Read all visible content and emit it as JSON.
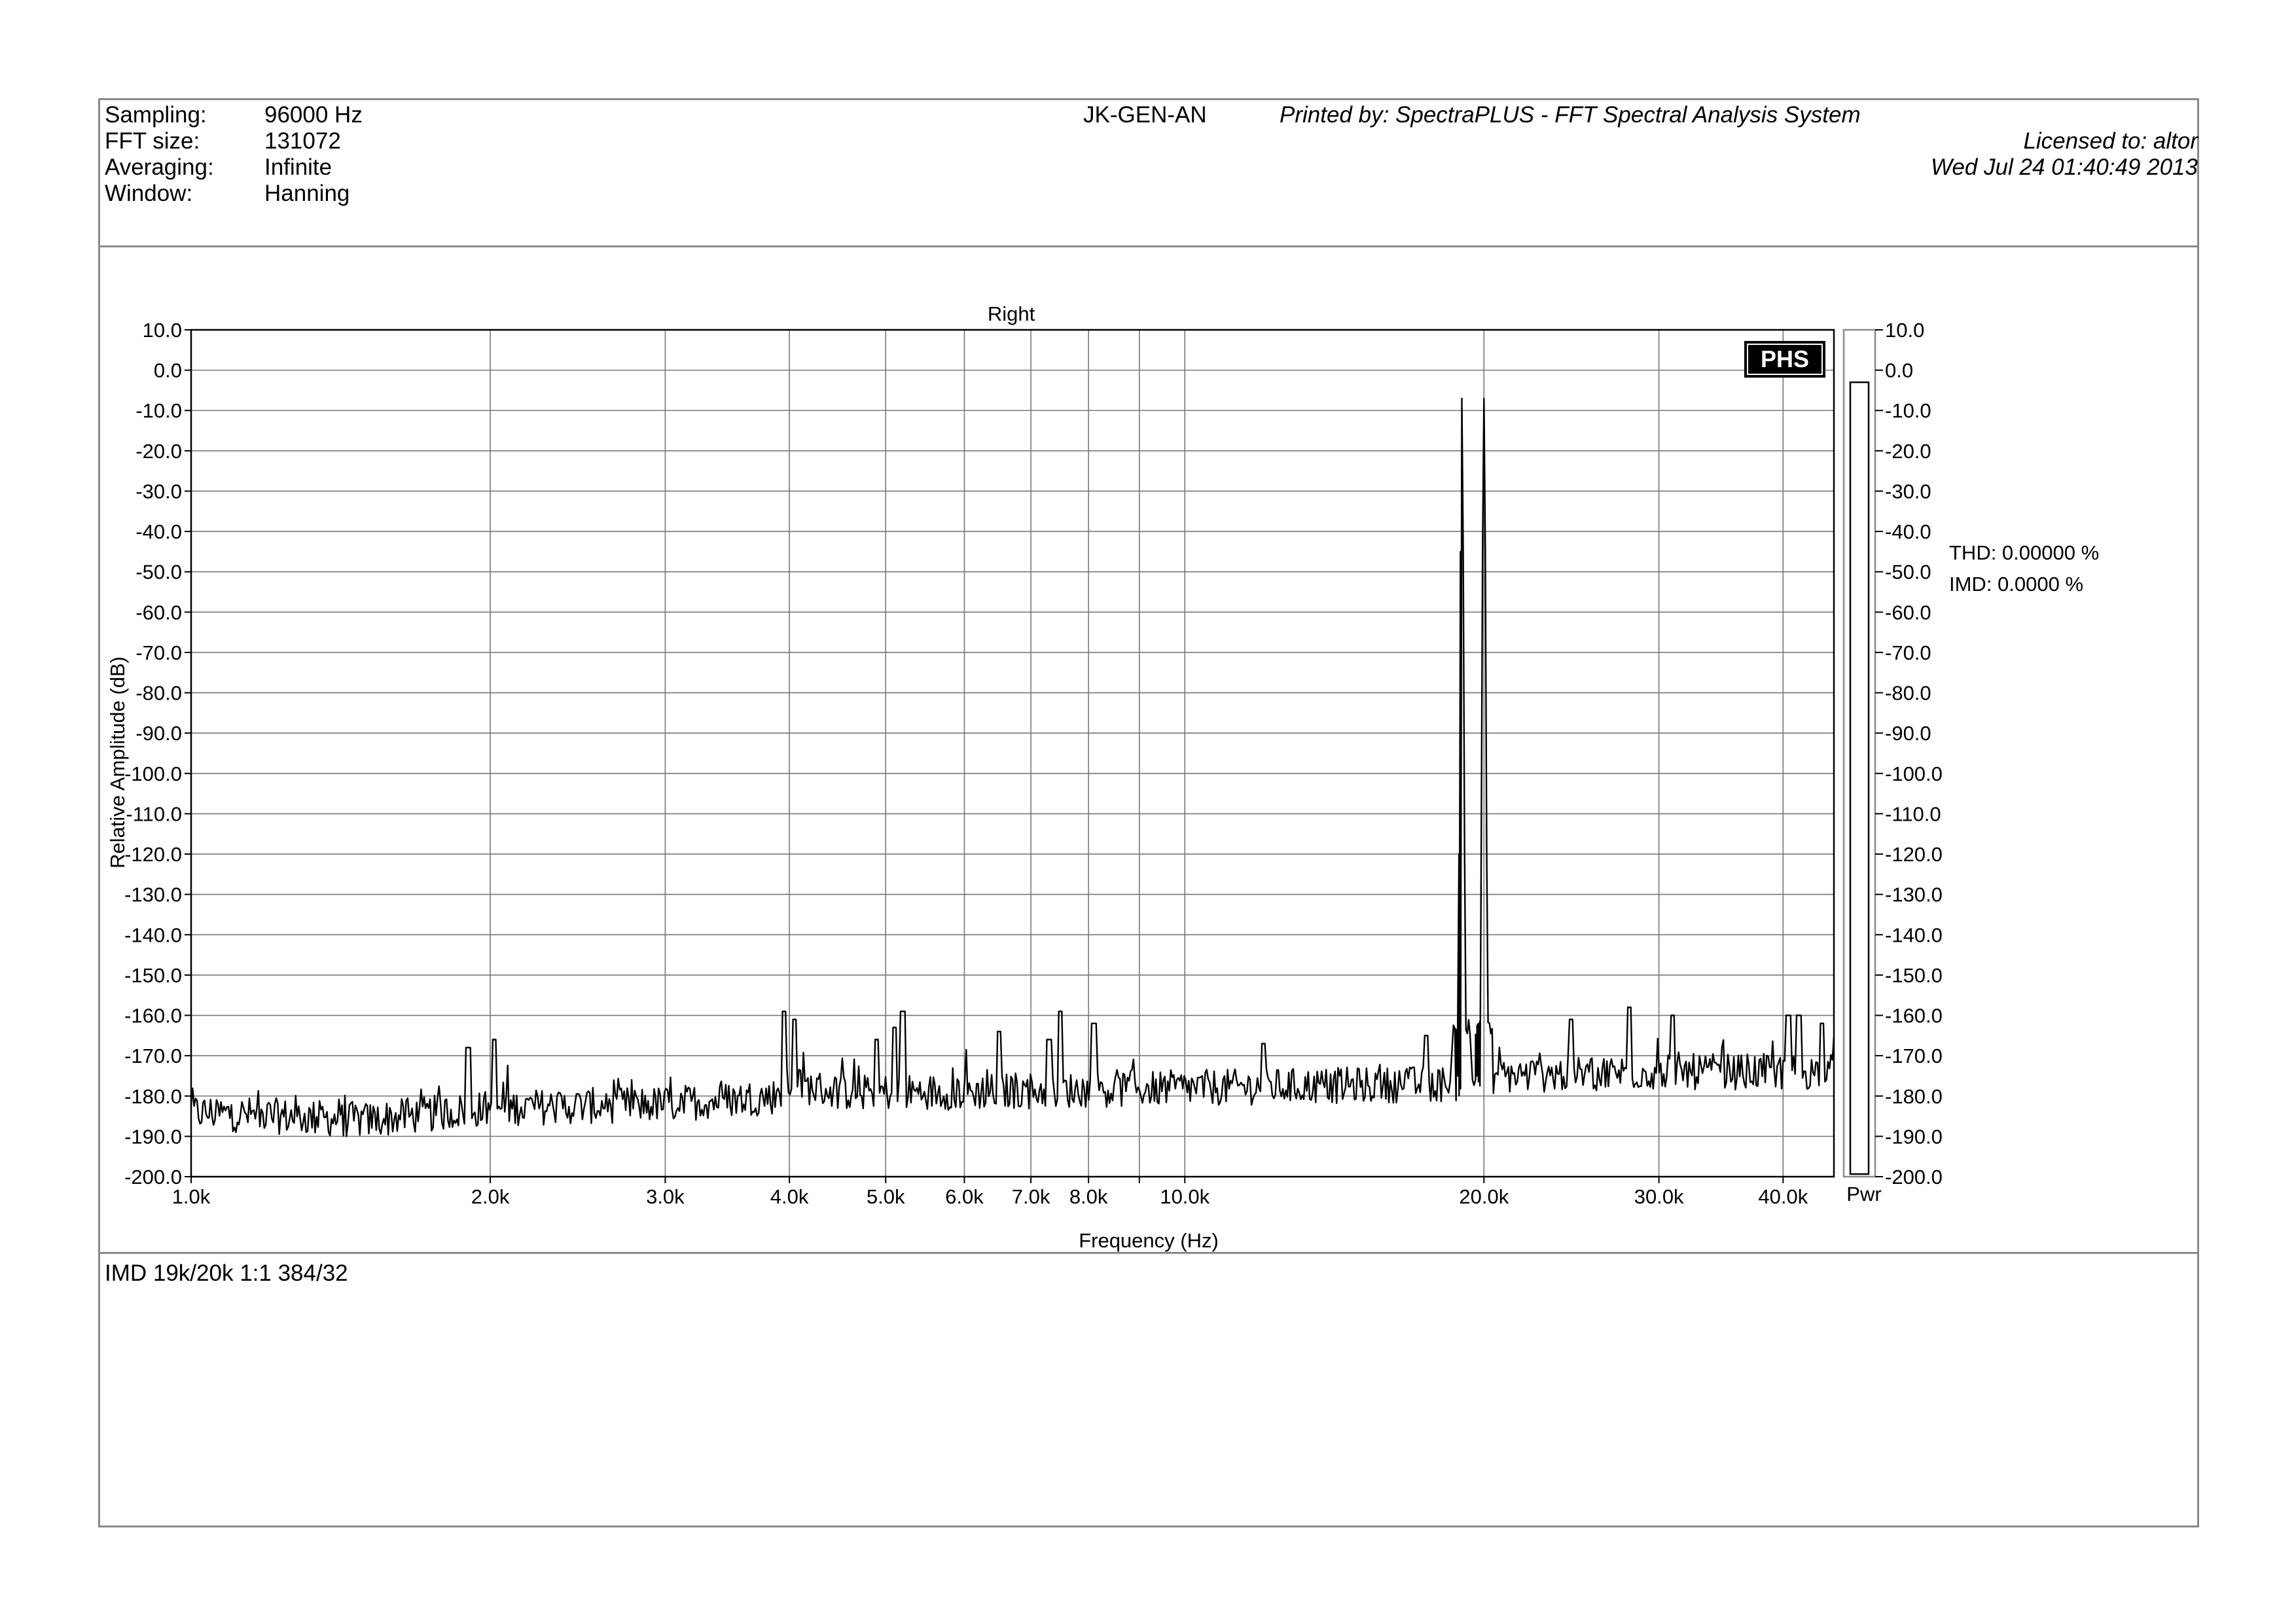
{
  "header": {
    "params": [
      {
        "label": "Sampling:",
        "value": "96000 Hz"
      },
      {
        "label": "FFT size:",
        "value": "131072"
      },
      {
        "label": "Averaging:",
        "value": "Infinite"
      },
      {
        "label": "Window:",
        "value": "Hanning"
      }
    ],
    "device": "JK-GEN-AN",
    "printed_by": "Printed by: SpectraPLUS - FFT Spectral Analysis System",
    "licensed_to": "Licensed to: altor",
    "timestamp": "Wed Jul 24 01:40:49 2013"
  },
  "footer": {
    "comment": "IMD 19k/20k 1:1 384/32"
  },
  "logo_text": "PHS",
  "stats": {
    "thd": "THD: 0.00000 %",
    "imd": "IMD: 0.0000 %"
  },
  "power_bar": {
    "label": "Pwr",
    "level_db": -3
  },
  "chart_data": {
    "type": "line",
    "title": "Right",
    "xlabel": "Frequency (Hz)",
    "ylabel": "Relative Amplitude (dB)",
    "x_scale": "log",
    "xlim": [
      1000,
      45000
    ],
    "ylim": [
      -200,
      10
    ],
    "grid": true,
    "x_ticks": [
      {
        "v": 1000,
        "label": "1.0k"
      },
      {
        "v": 2000,
        "label": "2.0k"
      },
      {
        "v": 3000,
        "label": "3.0k"
      },
      {
        "v": 4000,
        "label": "4.0k"
      },
      {
        "v": 5000,
        "label": "5.0k"
      },
      {
        "v": 6000,
        "label": "6.0k"
      },
      {
        "v": 7000,
        "label": "7.0k"
      },
      {
        "v": 8000,
        "label": "8.0k"
      },
      {
        "v": 9000,
        "label": ""
      },
      {
        "v": 10000,
        "label": "10.0k"
      },
      {
        "v": 20000,
        "label": "20.0k"
      },
      {
        "v": 30000,
        "label": "30.0k"
      },
      {
        "v": 40000,
        "label": "40.0k"
      }
    ],
    "y_ticks": [
      "10.0",
      "0.0",
      "-10.0",
      "-20.0",
      "-30.0",
      "-40.0",
      "-50.0",
      "-60.0",
      "-70.0",
      "-80.0",
      "-90.0",
      "-100.0",
      "-110.0",
      "-120.0",
      "-130.0",
      "-140.0",
      "-150.0",
      "-160.0",
      "-170.0",
      "-180.0",
      "-190.0",
      "-200.0"
    ],
    "noise_floor": [
      [
        1000,
        -184
      ],
      [
        1500,
        -186
      ],
      [
        2000,
        -183
      ],
      [
        3000,
        -182
      ],
      [
        3900,
        -180
      ],
      [
        4000,
        -177
      ],
      [
        4500,
        -179
      ],
      [
        6000,
        -179
      ],
      [
        10000,
        -178
      ],
      [
        18000,
        -177
      ],
      [
        18800,
        -177
      ],
      [
        20300,
        -175
      ],
      [
        30000,
        -174
      ],
      [
        45000,
        -174
      ]
    ],
    "peaks": [
      [
        1900,
        -168
      ],
      [
        2020,
        -166
      ],
      [
        3950,
        -159
      ],
      [
        4050,
        -161
      ],
      [
        4900,
        -166
      ],
      [
        5100,
        -163
      ],
      [
        5200,
        -159
      ],
      [
        6500,
        -164
      ],
      [
        7300,
        -166
      ],
      [
        7500,
        -159
      ],
      [
        8100,
        -162
      ],
      [
        12000,
        -167
      ],
      [
        17500,
        -165
      ],
      [
        24500,
        -161
      ],
      [
        28000,
        -158
      ],
      [
        31000,
        -160
      ],
      [
        40500,
        -160
      ],
      [
        41500,
        -160
      ],
      [
        43800,
        -162
      ]
    ],
    "series": [
      {
        "tones": [
          [
            19000,
            -7
          ],
          [
            20000,
            -7
          ]
        ]
      }
    ]
  }
}
